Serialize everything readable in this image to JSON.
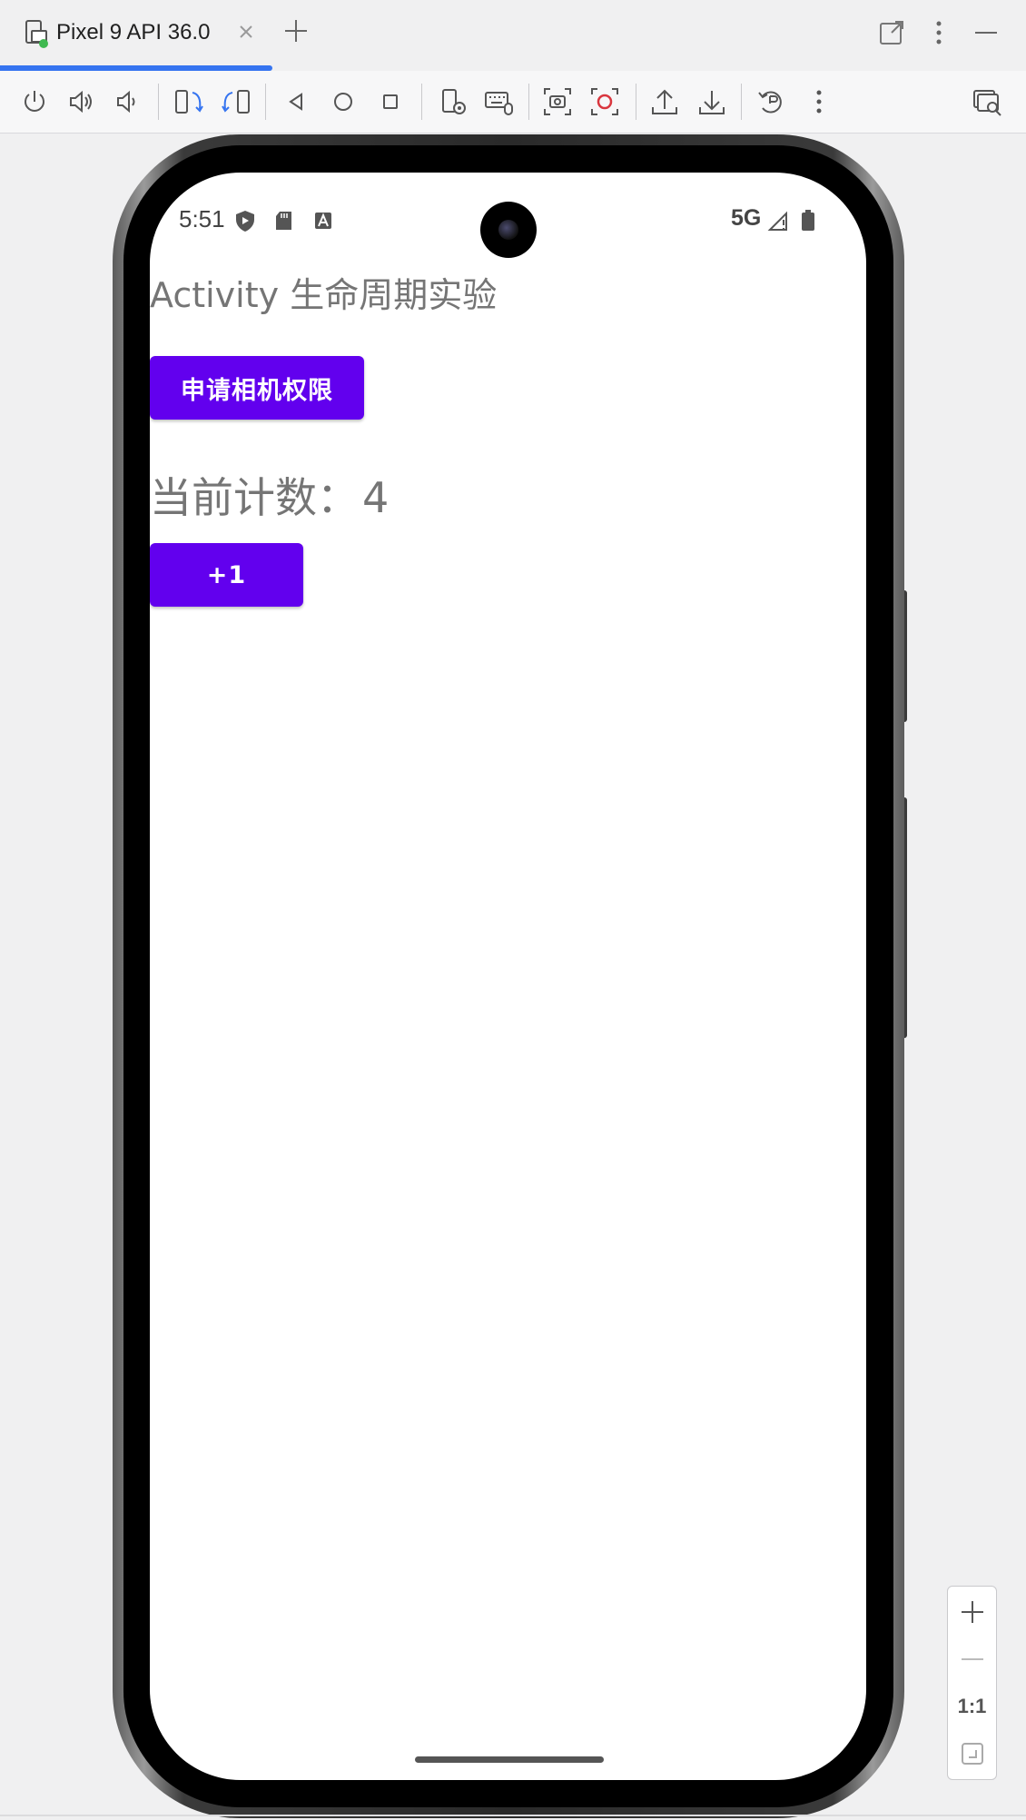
{
  "tab": {
    "title": "Pixel 9 API 36.0"
  },
  "toolbar": {
    "icons": [
      "power-icon",
      "volume-up-icon",
      "volume-down-icon",
      "rotate-left-icon",
      "rotate-right-icon",
      "back-icon",
      "home-icon",
      "overview-icon",
      "device-settings-icon",
      "keyboard-icon",
      "screenshot-icon",
      "screen-record-icon",
      "upload-icon",
      "download-icon",
      "snapshot-icon",
      "more-icon",
      "find-icon"
    ]
  },
  "device": {
    "status_bar": {
      "time": "5:51",
      "network": "5G"
    },
    "app": {
      "title": "Activity 生命周期实验",
      "permission_button": "申请相机权限",
      "count_label": "当前计数：",
      "count_value": "4",
      "increment_button": "+1"
    },
    "colors": {
      "button": "#6200ee",
      "text": "#757575"
    }
  },
  "zoom": {
    "actual_size_label": "1:1"
  }
}
